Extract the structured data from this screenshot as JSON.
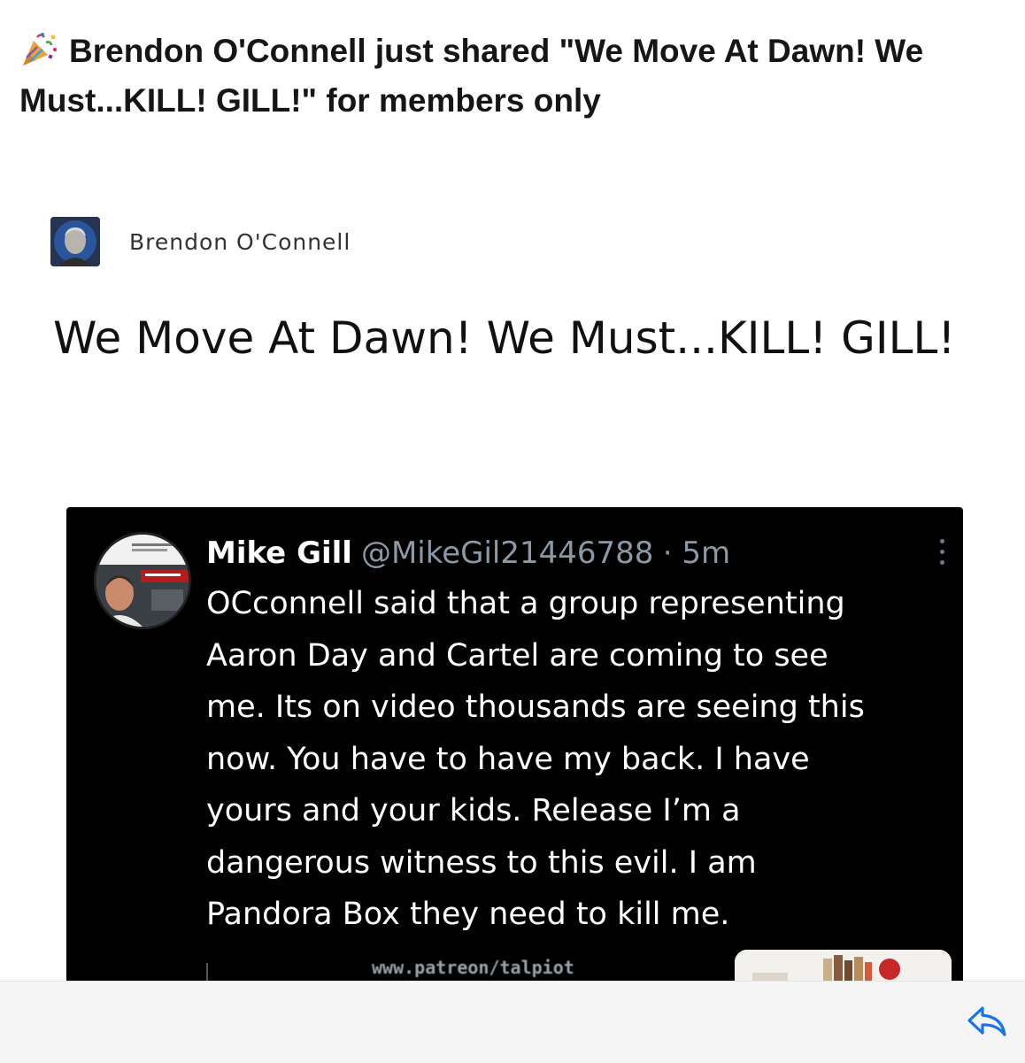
{
  "email": {
    "subject": "Brendon O'Connell just shared \"We Move At Dawn! We Must...KILL! GILL!\" for members only"
  },
  "post": {
    "author": "Brendon O'Connell",
    "title": "We Move At Dawn! We Must...KILL! GILL!"
  },
  "tweet": {
    "name": "Mike Gill",
    "handle": "@MikeGil21446788",
    "time": "· 5m",
    "text": "OCconnell said that a group representing\nAaron Day and Cartel are coming to see\nme. Its on video thousands are seeing this\nnow.  You have to have my back. I have\nyours and your kids. Release I’m a\ndangerous witness to this evil. I am\nPandora Box they need to kill me.",
    "watermark_url": "www.patreon/talpiot"
  },
  "icons": {
    "subject_icon": "party-popper-icon",
    "reply_icon": "reply-arrow-icon",
    "more_icon": "more-vertical-icon"
  },
  "colors": {
    "accent": "#1a73e8",
    "embed_bg": "#000000",
    "tweet_text": "#ffffff",
    "tweet_meta": "#8b98a5"
  }
}
